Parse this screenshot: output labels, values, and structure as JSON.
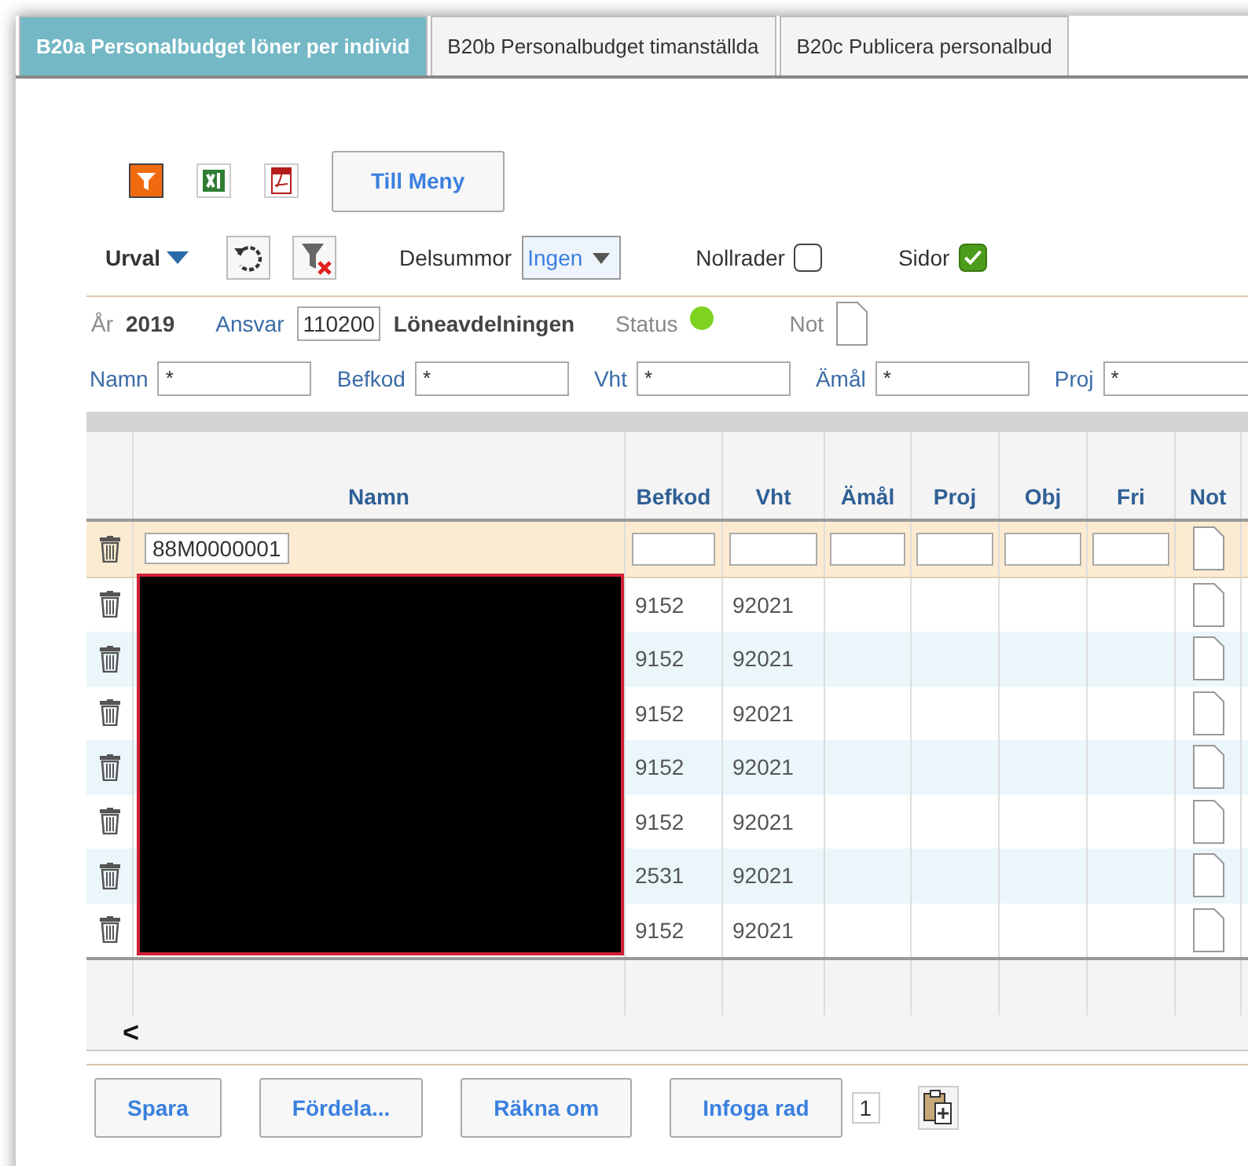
{
  "tabs": [
    {
      "label": "B20a Personalbudget löner per individ",
      "selected": true
    },
    {
      "label": "B20b Personalbudget timanställda",
      "selected": false
    },
    {
      "label": "B20c Publicera personalbud",
      "selected": false
    }
  ],
  "toolbar": {
    "menu_button": "Till Meny"
  },
  "filter_bar": {
    "urval": "Urval",
    "delsummor_label": "Delsummor",
    "delsummor_value": "Ingen",
    "nollrader_label": "Nollrader",
    "nollrader_checked": false,
    "sidor_label": "Sidor",
    "sidor_checked": true
  },
  "info": {
    "year_label": "År",
    "year": "2019",
    "ansvar_label": "Ansvar",
    "ansvar_value": "110200",
    "ansvar_name": "Löneavdelningen",
    "status_label": "Status",
    "status_ok": true,
    "not_label": "Not"
  },
  "search_fields": [
    {
      "label": "Namn",
      "value": "*"
    },
    {
      "label": "Befkod",
      "value": "*"
    },
    {
      "label": "Vht",
      "value": "*"
    },
    {
      "label": "Ämål",
      "value": "*"
    },
    {
      "label": "Proj",
      "value": "*"
    }
  ],
  "table": {
    "columns": [
      "Namn",
      "Befkod",
      "Vht",
      "Ämål",
      "Proj",
      "Obj",
      "Fri",
      "Not"
    ],
    "names_redacted": true,
    "rows": [
      {
        "kind": "input",
        "namn": "88M0000001"
      },
      {
        "kind": "data",
        "befkod": "9152",
        "vht": "92021"
      },
      {
        "kind": "data",
        "befkod": "9152",
        "vht": "92021"
      },
      {
        "kind": "data",
        "befkod": "9152",
        "vht": "92021"
      },
      {
        "kind": "data",
        "befkod": "9152",
        "vht": "92021"
      },
      {
        "kind": "data",
        "befkod": "9152",
        "vht": "92021"
      },
      {
        "kind": "data",
        "befkod": "2531",
        "vht": "92021"
      },
      {
        "kind": "data",
        "befkod": "9152",
        "vht": "92021"
      }
    ],
    "scroll_left": "<"
  },
  "buttons": [
    "Spara",
    "Fördela...",
    "Räkna om",
    "Infoga rad"
  ],
  "insert_count": "1"
}
